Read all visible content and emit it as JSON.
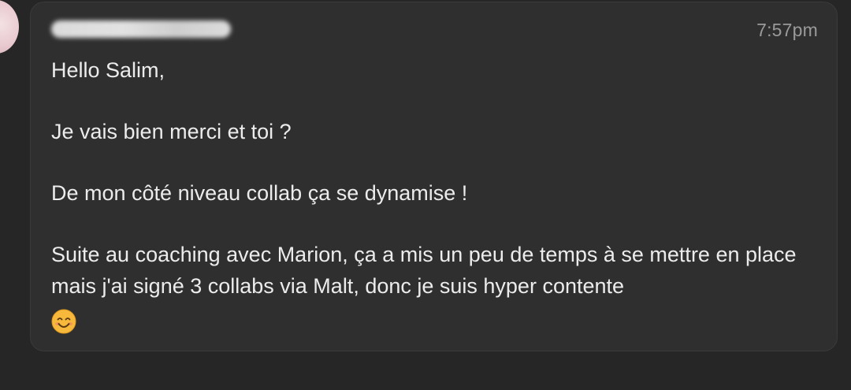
{
  "message": {
    "sender_name": "",
    "time": "7:57pm",
    "paragraphs": [
      "Hello Salim,",
      "Je vais bien merci et toi ?",
      "De mon côté niveau collab ça se dynamise !",
      "Suite au coaching avec Marion, ça a mis un peu de temps à se mettre en place mais j'ai signé 3 collabs via Malt, donc je suis hyper contente"
    ],
    "emoji": "smiling-face-with-smiling-eyes"
  }
}
